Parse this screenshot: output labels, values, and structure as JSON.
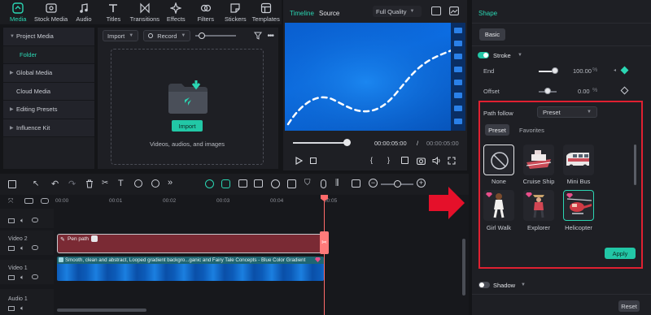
{
  "toolbar": {
    "items": [
      {
        "label": "Media",
        "icon": "media-icon",
        "active": true
      },
      {
        "label": "Stock Media",
        "icon": "stock-media-icon"
      },
      {
        "label": "Audio",
        "icon": "music-note-icon"
      },
      {
        "label": "Titles",
        "icon": "text-t-icon"
      },
      {
        "label": "Transitions",
        "icon": "transitions-icon"
      },
      {
        "label": "Effects",
        "icon": "effects-icon"
      },
      {
        "label": "Filters",
        "icon": "filters-icon"
      },
      {
        "label": "Stickers",
        "icon": "stickers-icon"
      },
      {
        "label": "Templates",
        "icon": "templates-icon"
      }
    ]
  },
  "sidebar": {
    "items": [
      {
        "label": "Project Media",
        "expanded": true
      },
      {
        "label": "Folder",
        "selected": true
      },
      {
        "label": "Global Media"
      },
      {
        "label": "Cloud Media"
      },
      {
        "label": "Editing Presets"
      },
      {
        "label": "Influence Kit"
      }
    ]
  },
  "media": {
    "import_dropdown": "Import",
    "record_dropdown": "Record",
    "import_button": "Import",
    "hint": "Videos, audios, and images"
  },
  "player": {
    "tab_timeline": "Timeline",
    "tab_source": "Source",
    "quality": "Full Quality",
    "current_time": "00:00:05:00",
    "separator": "/",
    "total_time": "00:00:05:00"
  },
  "right_panel": {
    "title": "Shape",
    "tab_basic": "Basic",
    "stroke_label": "Stroke",
    "end_label": "End",
    "end_value": "100.00",
    "end_unit": "%",
    "end_fraction": 1.0,
    "offset_label": "Offset",
    "offset_value": "0.00",
    "offset_unit": "%",
    "path_follow_label": "Path follow",
    "path_follow_value": "Preset",
    "subtab_preset": "Preset",
    "subtab_favorites": "Favorites",
    "presets": [
      {
        "label": "None"
      },
      {
        "label": "Cruise Ship"
      },
      {
        "label": "Mini Bus"
      },
      {
        "label": "Girl Walk"
      },
      {
        "label": "Explorer"
      },
      {
        "label": "Helicopter",
        "selected": true
      }
    ],
    "apply_button": "Apply",
    "shadow_label": "Shadow",
    "reset_button": "Reset"
  },
  "timeline": {
    "ruler_ticks": [
      "00:00",
      "00:01",
      "00:02",
      "00:03",
      "00:04",
      "00:05"
    ],
    "tracks": [
      {
        "label": "Video 2"
      },
      {
        "label": "Video 1"
      },
      {
        "label": "Audio 1"
      }
    ],
    "clip_path": "Pen path",
    "clip_video": "Smooth, clean and abstract, Looped gradient backgro...ganic and Fairy Tale Concepts - Blue Color Gradient"
  },
  "colors": {
    "accent": "#2bd6b3",
    "highlight_border": "#e02031",
    "clip_red": "#7a2a34",
    "playhead": "#ff6a6a"
  }
}
